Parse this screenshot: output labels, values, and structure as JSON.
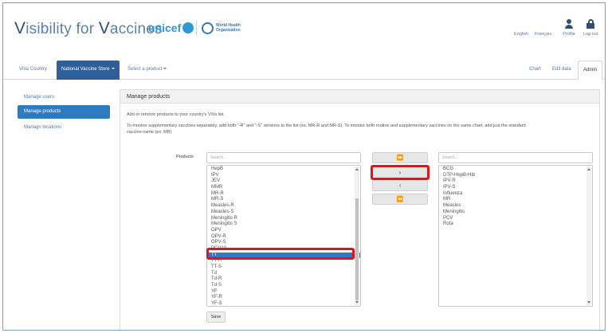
{
  "header": {
    "title_initial_v": "V",
    "title_rest_1": "isibility for ",
    "title_initial_v2": "V",
    "title_rest_2": "accines",
    "unicef_label": "unicef",
    "who_label_line1": "World Health",
    "who_label_line2": "Organization",
    "lang_english": "English",
    "lang_french": "Français",
    "profile_label": "Profile",
    "logout_label": "Log out"
  },
  "nav": {
    "viva_country": "ViVa Country",
    "national_vaccine_store": "National Vaccine Store",
    "select_product": "Select a product",
    "chart": "Chart",
    "edit_data": "Edit data",
    "admin": "Admin"
  },
  "sidebar": {
    "items": [
      {
        "label": "Manage users"
      },
      {
        "label": "Manage products"
      },
      {
        "label": "Managn locations"
      }
    ]
  },
  "panel": {
    "title": "Manage products",
    "line1": "Add or remove products to your country's ViVa list.",
    "line2": "To monitor supplementary vaccines separately, add both \"-R\" and \"-S\" versions to the list (ex: MR-R and MR-S). To monitor both routine and supplementary vaccines on the same chart, add just the standard",
    "line3": "vaccine name (ex: MR)",
    "products_label": "Products",
    "search_placeholder_left": "Search...",
    "search_placeholder_right": "Search...",
    "available_products": [
      "HepB",
      "IPV",
      "JEV",
      "MMR",
      "MR-R",
      "MR-S",
      "Measles-R",
      "Measles-S",
      "Meningitis R",
      "Meningitis S",
      "OPV",
      "OPV-R",
      "OPV-S",
      "PCV10",
      "TT",
      "TT-R",
      "TT-S",
      "Td",
      "Td-R",
      "Td-S",
      "YF",
      "YF-R",
      "YF-S"
    ],
    "selected_available_index": 14,
    "chosen_products": [
      "BCG",
      "DTP-HepB-Hib",
      "IPV-R",
      "IPV-S",
      "Influenza",
      "MR",
      "Measles",
      "Meningitis",
      "PCV",
      "Rota"
    ],
    "buttons": {
      "add_all": "⏩",
      "add_one": "›",
      "remove_one": "‹",
      "remove_all": "⏪",
      "save": "Save"
    }
  },
  "colors": {
    "accent": "#2f7bc2",
    "nav_dropdown": "#2f5f99",
    "highlight": "#e0141a"
  }
}
